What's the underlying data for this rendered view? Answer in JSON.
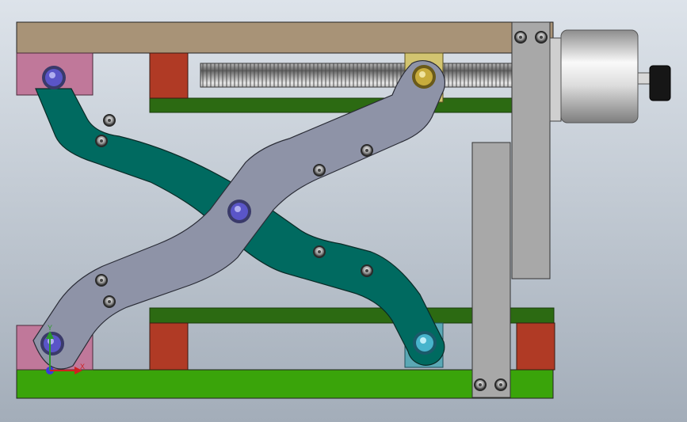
{
  "view": {
    "name": "cad-viewport",
    "background_top": "#dde3ea",
    "background_bottom": "#a3adb9"
  },
  "colors": {
    "top_plate": "#a89377",
    "base_plate": "#3aa40a",
    "upper_rail": "#2c6a12",
    "lower_rail": "#2c6a12",
    "red_block": "#b03a25",
    "pink_block": "#c0789a",
    "teal_arm": "#006a60",
    "gray_arm": "#8e93a7",
    "bar_gray": "#a8a8a8",
    "yellow_block": "#d2c470",
    "cyan_block": "#5aa8b5",
    "motor_light": "#f5f5f5",
    "motor_dark": "#8a8a8a",
    "knob": "#161616",
    "pivot_blue": "#5a55c8",
    "pivot_gold": "#c8ac3c",
    "pivot_cyan": "#48b4cc"
  },
  "triad": {
    "x_label": "X",
    "y_label": "Y",
    "x_icon": "x-axis-arrow-icon",
    "y_icon": "y-axis-arrow-icon",
    "origin_icon": "origin-icon"
  }
}
